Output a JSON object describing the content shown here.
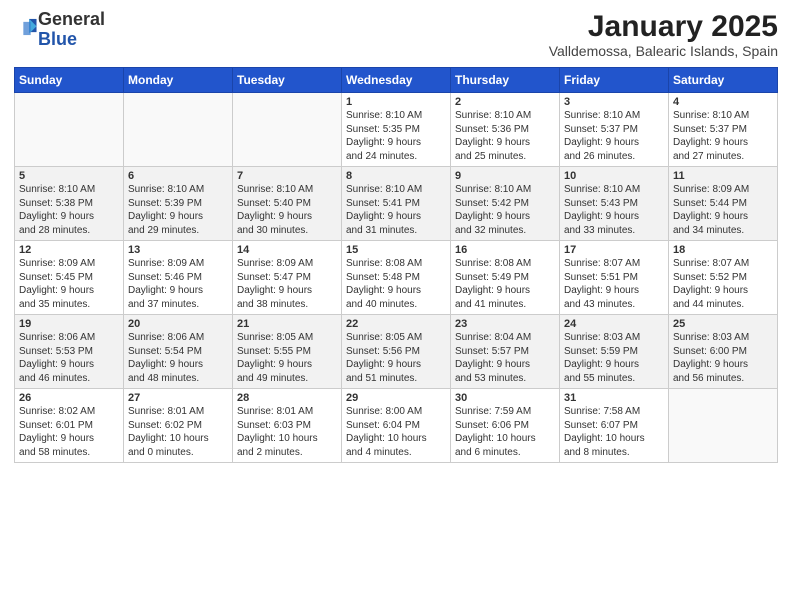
{
  "header": {
    "logo_general": "General",
    "logo_blue": "Blue",
    "title": "January 2025",
    "subtitle": "Valldemossa, Balearic Islands, Spain"
  },
  "weekdays": [
    "Sunday",
    "Monday",
    "Tuesday",
    "Wednesday",
    "Thursday",
    "Friday",
    "Saturday"
  ],
  "weeks": [
    [
      {
        "day": "",
        "info": ""
      },
      {
        "day": "",
        "info": ""
      },
      {
        "day": "",
        "info": ""
      },
      {
        "day": "1",
        "info": "Sunrise: 8:10 AM\nSunset: 5:35 PM\nDaylight: 9 hours\nand 24 minutes."
      },
      {
        "day": "2",
        "info": "Sunrise: 8:10 AM\nSunset: 5:36 PM\nDaylight: 9 hours\nand 25 minutes."
      },
      {
        "day": "3",
        "info": "Sunrise: 8:10 AM\nSunset: 5:37 PM\nDaylight: 9 hours\nand 26 minutes."
      },
      {
        "day": "4",
        "info": "Sunrise: 8:10 AM\nSunset: 5:37 PM\nDaylight: 9 hours\nand 27 minutes."
      }
    ],
    [
      {
        "day": "5",
        "info": "Sunrise: 8:10 AM\nSunset: 5:38 PM\nDaylight: 9 hours\nand 28 minutes."
      },
      {
        "day": "6",
        "info": "Sunrise: 8:10 AM\nSunset: 5:39 PM\nDaylight: 9 hours\nand 29 minutes."
      },
      {
        "day": "7",
        "info": "Sunrise: 8:10 AM\nSunset: 5:40 PM\nDaylight: 9 hours\nand 30 minutes."
      },
      {
        "day": "8",
        "info": "Sunrise: 8:10 AM\nSunset: 5:41 PM\nDaylight: 9 hours\nand 31 minutes."
      },
      {
        "day": "9",
        "info": "Sunrise: 8:10 AM\nSunset: 5:42 PM\nDaylight: 9 hours\nand 32 minutes."
      },
      {
        "day": "10",
        "info": "Sunrise: 8:10 AM\nSunset: 5:43 PM\nDaylight: 9 hours\nand 33 minutes."
      },
      {
        "day": "11",
        "info": "Sunrise: 8:09 AM\nSunset: 5:44 PM\nDaylight: 9 hours\nand 34 minutes."
      }
    ],
    [
      {
        "day": "12",
        "info": "Sunrise: 8:09 AM\nSunset: 5:45 PM\nDaylight: 9 hours\nand 35 minutes."
      },
      {
        "day": "13",
        "info": "Sunrise: 8:09 AM\nSunset: 5:46 PM\nDaylight: 9 hours\nand 37 minutes."
      },
      {
        "day": "14",
        "info": "Sunrise: 8:09 AM\nSunset: 5:47 PM\nDaylight: 9 hours\nand 38 minutes."
      },
      {
        "day": "15",
        "info": "Sunrise: 8:08 AM\nSunset: 5:48 PM\nDaylight: 9 hours\nand 40 minutes."
      },
      {
        "day": "16",
        "info": "Sunrise: 8:08 AM\nSunset: 5:49 PM\nDaylight: 9 hours\nand 41 minutes."
      },
      {
        "day": "17",
        "info": "Sunrise: 8:07 AM\nSunset: 5:51 PM\nDaylight: 9 hours\nand 43 minutes."
      },
      {
        "day": "18",
        "info": "Sunrise: 8:07 AM\nSunset: 5:52 PM\nDaylight: 9 hours\nand 44 minutes."
      }
    ],
    [
      {
        "day": "19",
        "info": "Sunrise: 8:06 AM\nSunset: 5:53 PM\nDaylight: 9 hours\nand 46 minutes."
      },
      {
        "day": "20",
        "info": "Sunrise: 8:06 AM\nSunset: 5:54 PM\nDaylight: 9 hours\nand 48 minutes."
      },
      {
        "day": "21",
        "info": "Sunrise: 8:05 AM\nSunset: 5:55 PM\nDaylight: 9 hours\nand 49 minutes."
      },
      {
        "day": "22",
        "info": "Sunrise: 8:05 AM\nSunset: 5:56 PM\nDaylight: 9 hours\nand 51 minutes."
      },
      {
        "day": "23",
        "info": "Sunrise: 8:04 AM\nSunset: 5:57 PM\nDaylight: 9 hours\nand 53 minutes."
      },
      {
        "day": "24",
        "info": "Sunrise: 8:03 AM\nSunset: 5:59 PM\nDaylight: 9 hours\nand 55 minutes."
      },
      {
        "day": "25",
        "info": "Sunrise: 8:03 AM\nSunset: 6:00 PM\nDaylight: 9 hours\nand 56 minutes."
      }
    ],
    [
      {
        "day": "26",
        "info": "Sunrise: 8:02 AM\nSunset: 6:01 PM\nDaylight: 9 hours\nand 58 minutes."
      },
      {
        "day": "27",
        "info": "Sunrise: 8:01 AM\nSunset: 6:02 PM\nDaylight: 10 hours\nand 0 minutes."
      },
      {
        "day": "28",
        "info": "Sunrise: 8:01 AM\nSunset: 6:03 PM\nDaylight: 10 hours\nand 2 minutes."
      },
      {
        "day": "29",
        "info": "Sunrise: 8:00 AM\nSunset: 6:04 PM\nDaylight: 10 hours\nand 4 minutes."
      },
      {
        "day": "30",
        "info": "Sunrise: 7:59 AM\nSunset: 6:06 PM\nDaylight: 10 hours\nand 6 minutes."
      },
      {
        "day": "31",
        "info": "Sunrise: 7:58 AM\nSunset: 6:07 PM\nDaylight: 10 hours\nand 8 minutes."
      },
      {
        "day": "",
        "info": ""
      }
    ]
  ]
}
